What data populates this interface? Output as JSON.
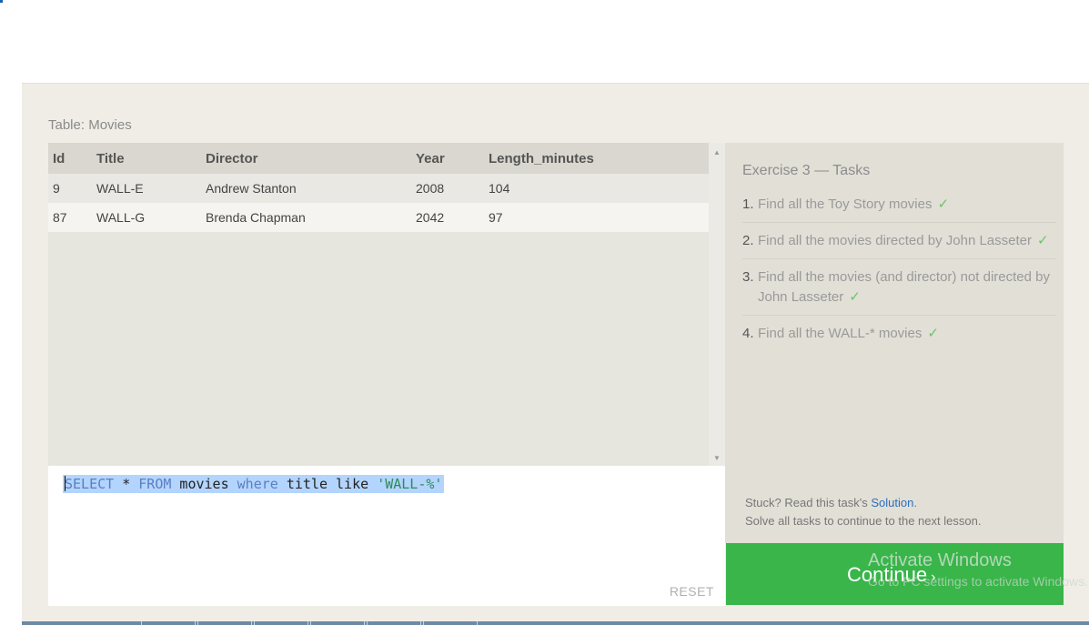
{
  "table": {
    "label": "Table: Movies",
    "columns": [
      "Id",
      "Title",
      "Director",
      "Year",
      "Length_minutes"
    ],
    "rows": [
      [
        "9",
        "WALL-E",
        "Andrew Stanton",
        "2008",
        "104"
      ],
      [
        "87",
        "WALL-G",
        "Brenda Chapman",
        "2042",
        "97"
      ]
    ]
  },
  "editor": {
    "query_parts": {
      "select": "SELECT",
      "star": " * ",
      "from": "FROM",
      "movies": " movies ",
      "where": "where",
      "title_like": " title like ",
      "literal": "'WALL-%'"
    },
    "reset_label": "RESET"
  },
  "tasks": {
    "title": "Exercise 3 — Tasks",
    "items": [
      {
        "num": "1.",
        "text": "Find all the Toy Story movies",
        "check": "✓"
      },
      {
        "num": "2.",
        "text": "Find all the movies directed by John Lasseter",
        "check": "✓"
      },
      {
        "num": "3.",
        "text": "Find all the movies (and director) not directed by John Lasseter",
        "check": "✓"
      },
      {
        "num": "4.",
        "text": "Find all the WALL-* movies",
        "check": "✓"
      }
    ]
  },
  "help": {
    "stuck_prefix": "Stuck? Read this task's ",
    "solution_link": "Solution",
    "stuck_suffix": ".",
    "solve_all": "Solve all tasks to continue to the next lesson."
  },
  "continue": {
    "label": "Continue",
    "arrow": "›"
  },
  "watermark": {
    "title": "Activate Windows",
    "subtitle": "Go to PC settings to activate Windows."
  },
  "colors": {
    "continue_green": "#39b54a",
    "selection": "#b3d4fc",
    "check_green": "#6cc36c",
    "link_blue": "#2d6fbd"
  }
}
